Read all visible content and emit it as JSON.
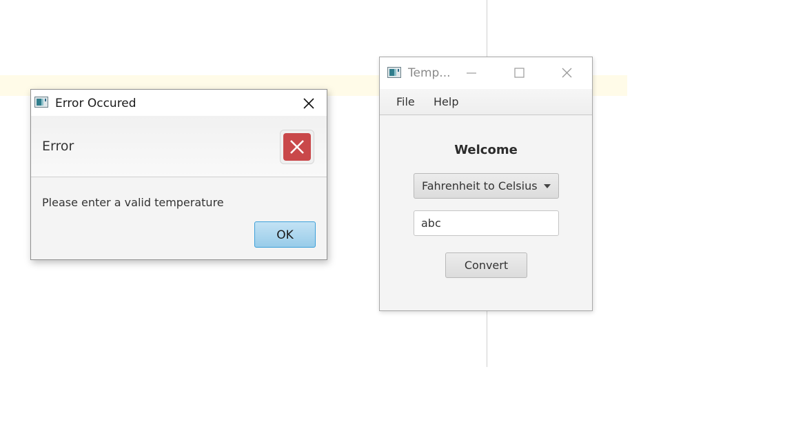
{
  "error_dialog": {
    "title": "Error Occured",
    "header": "Error",
    "message": "Please enter a valid temperature",
    "ok_label": "OK",
    "icons": {
      "app": "java-app-icon",
      "close": "close-icon",
      "error": "error-x-icon"
    },
    "colors": {
      "error_red": "#c9484a",
      "ok_blue": "#98cce9"
    }
  },
  "temp_window": {
    "title": "Temp...",
    "menu": {
      "file": "File",
      "help": "Help"
    },
    "welcome": "Welcome",
    "conversion_select": {
      "selected": "Fahrenheit to Celsius"
    },
    "temperature_input": {
      "value": "abc"
    },
    "convert_label": "Convert",
    "icons": {
      "app": "java-app-icon",
      "minimize": "minimize-icon",
      "maximize": "maximize-icon",
      "close": "close-icon",
      "dropdown": "caret-down-icon"
    }
  }
}
